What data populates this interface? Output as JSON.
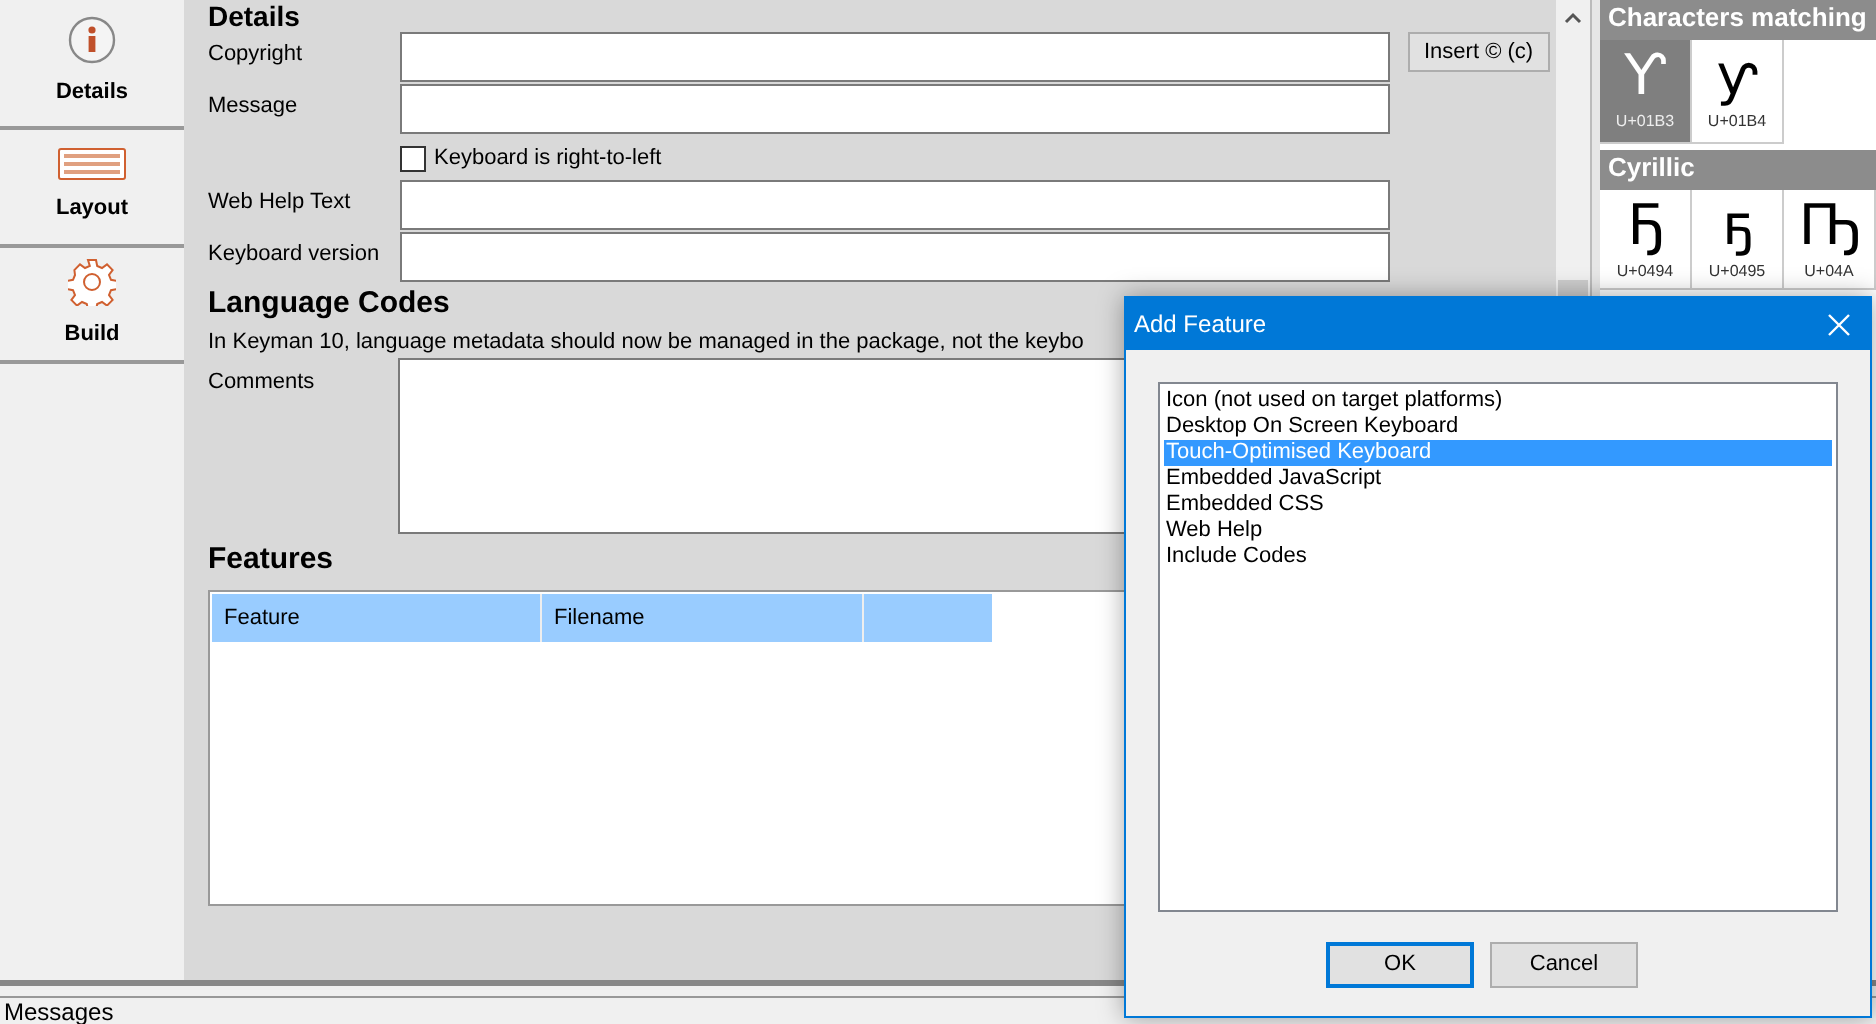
{
  "sidebar": {
    "tabs": [
      {
        "label": "Details"
      },
      {
        "label": "Layout"
      },
      {
        "label": "Build"
      }
    ]
  },
  "details": {
    "heading": "Details",
    "fields": [
      {
        "kind": "text",
        "label": "Copyright",
        "button": "Insert © (c)"
      },
      {
        "kind": "text",
        "label": "Message"
      },
      {
        "kind": "checkbox",
        "label": "Keyboard is right-to-left",
        "checked": false
      },
      {
        "kind": "text",
        "label": "Web Help Text"
      },
      {
        "kind": "text",
        "label": "Keyboard version"
      }
    ]
  },
  "language_codes": {
    "heading": "Language Codes",
    "note": "In Keyman 10, language metadata should now be managed in the package, not the keybo",
    "comments_label": "Comments"
  },
  "features": {
    "heading": "Features",
    "columns": [
      "Feature",
      "Filename"
    ]
  },
  "character_map": {
    "groups": [
      {
        "title": "Characters matching",
        "chars": [
          {
            "glyph": "Ƴ",
            "code": "U+01B3",
            "selected": true
          },
          {
            "glyph": "ƴ",
            "code": "U+01B4",
            "selected": false
          }
        ]
      },
      {
        "title": "Cyrillic",
        "chars": [
          {
            "glyph": "Ҕ",
            "code": "U+0494",
            "selected": false
          },
          {
            "glyph": "ҕ",
            "code": "U+0495",
            "selected": false
          },
          {
            "glyph": "Ҧ",
            "code": "U+04A",
            "selected": false
          }
        ]
      }
    ]
  },
  "messages": {
    "title": "Messages"
  },
  "dialog": {
    "title": "Add Feature",
    "items": [
      {
        "label": "Icon (not used on target platforms)",
        "selected": false
      },
      {
        "label": "Desktop On Screen Keyboard",
        "selected": false
      },
      {
        "label": "Touch-Optimised Keyboard",
        "selected": true
      },
      {
        "label": "Embedded JavaScript",
        "selected": false
      },
      {
        "label": "Embedded CSS",
        "selected": false
      },
      {
        "label": "Web Help",
        "selected": false
      },
      {
        "label": "Include Codes",
        "selected": false
      }
    ],
    "buttons": [
      {
        "label": "OK",
        "default": true
      },
      {
        "label": "Cancel",
        "default": false
      }
    ]
  }
}
